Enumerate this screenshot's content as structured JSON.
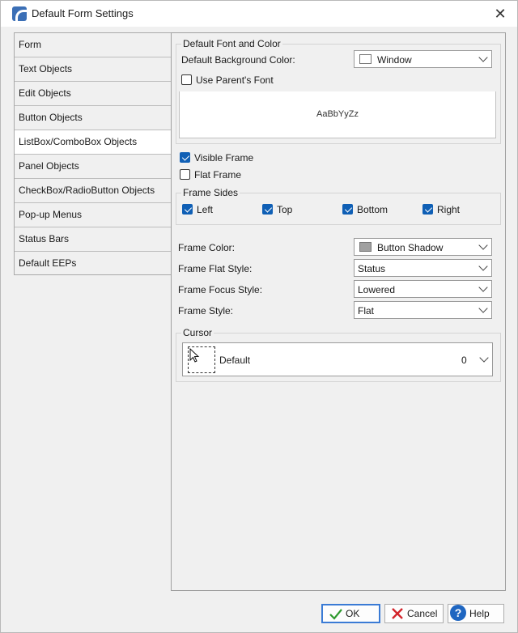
{
  "window": {
    "title": "Default Form Settings"
  },
  "nav": {
    "items": [
      {
        "label": "Form",
        "selected": false
      },
      {
        "label": "Text Objects",
        "selected": false
      },
      {
        "label": "Edit Objects",
        "selected": false
      },
      {
        "label": "Button Objects",
        "selected": false
      },
      {
        "label": "ListBox/ComboBox Objects",
        "selected": true
      },
      {
        "label": "Panel Objects",
        "selected": false
      },
      {
        "label": "CheckBox/RadioButton Objects",
        "selected": false
      },
      {
        "label": "Pop-up Menus",
        "selected": false
      },
      {
        "label": "Status Bars",
        "selected": false
      },
      {
        "label": "Default EEPs",
        "selected": false
      }
    ]
  },
  "font_color": {
    "group_title": "Default Font and Color",
    "bg_label": "Default Background Color:",
    "bg_value": "Window",
    "bg_swatch": "#ffffff",
    "use_parent_font_label": "Use Parent's Font",
    "use_parent_font_checked": false,
    "sample_text": "AaBbYyZz"
  },
  "frame": {
    "visible_label": "Visible Frame",
    "visible_checked": true,
    "flat_label": "Flat Frame",
    "flat_checked": false
  },
  "frame_sides": {
    "group_title": "Frame Sides",
    "left": {
      "label": "Left",
      "checked": true
    },
    "top": {
      "label": "Top",
      "checked": true
    },
    "bottom": {
      "label": "Bottom",
      "checked": true
    },
    "right": {
      "label": "Right",
      "checked": true
    }
  },
  "frame_props": {
    "color_label": "Frame Color:",
    "color_value": "Button Shadow",
    "color_swatch": "#a0a0a0",
    "flat_style_label": "Frame Flat Style:",
    "flat_style_value": "Status",
    "focus_style_label": "Frame Focus Style:",
    "focus_style_value": "Lowered",
    "style_label": "Frame Style:",
    "style_value": "Flat"
  },
  "cursor": {
    "group_title": "Cursor",
    "name": "Default",
    "number": "0"
  },
  "buttons": {
    "ok": "OK",
    "cancel": "Cancel",
    "help": "Help"
  },
  "colors": {
    "accent": "#0f5fb5",
    "default_button_border": "#3a7bd5"
  }
}
